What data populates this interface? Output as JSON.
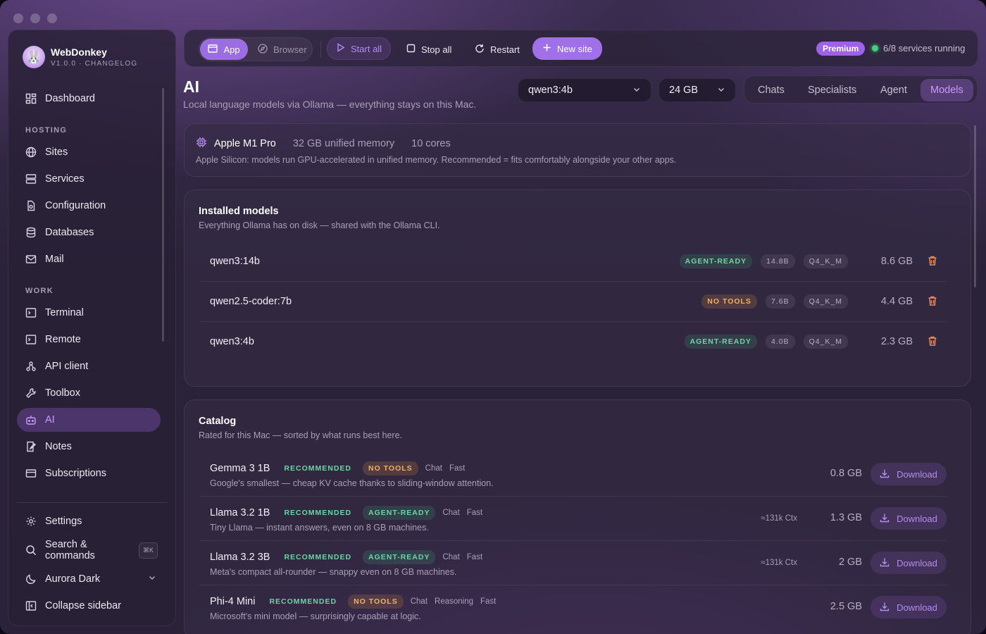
{
  "app": {
    "name": "WebDonkey",
    "version": "V1.0.0 · CHANGELOG"
  },
  "sidebar": {
    "items_top": [
      {
        "label": "Dashboard",
        "icon": "dashboard-icon"
      }
    ],
    "hosting_label": "HOSTING",
    "hosting": [
      {
        "label": "Sites",
        "icon": "globe-icon"
      },
      {
        "label": "Services",
        "icon": "server-icon"
      },
      {
        "label": "Configuration",
        "icon": "config-file-icon"
      },
      {
        "label": "Databases",
        "icon": "database-icon"
      },
      {
        "label": "Mail",
        "icon": "mail-icon"
      }
    ],
    "work_label": "WORK",
    "work": [
      {
        "label": "Terminal",
        "icon": "terminal-icon"
      },
      {
        "label": "Remote",
        "icon": "remote-terminal-icon"
      },
      {
        "label": "API client",
        "icon": "api-icon"
      },
      {
        "label": "Toolbox",
        "icon": "wrench-icon"
      },
      {
        "label": "AI",
        "icon": "robot-icon",
        "active": true
      },
      {
        "label": "Notes",
        "icon": "notes-icon"
      },
      {
        "label": "Subscriptions",
        "icon": "card-icon"
      }
    ],
    "bottom": {
      "settings": "Settings",
      "search": "Search & commands",
      "search_kbd": "⌘K",
      "theme": "Aurora Dark",
      "collapse": "Collapse sidebar"
    }
  },
  "toolbar": {
    "app": "App",
    "browser": "Browser",
    "start_all": "Start all",
    "stop_all": "Stop all",
    "restart": "Restart",
    "new_site": "New site",
    "premium": "Premium",
    "services_status": "6/8 services running"
  },
  "header": {
    "title": "AI",
    "subtitle": "Local language models via Ollama — everything stays on this Mac.",
    "model_select": "qwen3:4b",
    "memory_select": "24 GB",
    "tabs": [
      "Chats",
      "Specialists",
      "Agent",
      "Models"
    ],
    "active_tab": "Models"
  },
  "hardware": {
    "chip": "Apple M1 Pro",
    "memory": "32 GB unified memory",
    "cores": "10 cores",
    "note": "Apple Silicon: models run GPU-accelerated in unified memory. Recommended = fits comfortably alongside your other apps."
  },
  "installed": {
    "title": "Installed models",
    "subtitle": "Everything Ollama has on disk — shared with the Ollama CLI.",
    "models": [
      {
        "name": "qwen3:14b",
        "badge": "AGENT-READY",
        "badge_color": "green",
        "params": "14.8B",
        "quant": "Q4_K_M",
        "size": "8.6 GB"
      },
      {
        "name": "qwen2.5-coder:7b",
        "badge": "NO TOOLS",
        "badge_color": "orange",
        "params": "7.6B",
        "quant": "Q4_K_M",
        "size": "4.4 GB"
      },
      {
        "name": "qwen3:4b",
        "badge": "AGENT-READY",
        "badge_color": "green",
        "params": "4.0B",
        "quant": "Q4_K_M",
        "size": "2.3 GB"
      }
    ]
  },
  "catalog": {
    "title": "Catalog",
    "subtitle": "Rated for this Mac — sorted by what runs best here.",
    "download_label": "Download",
    "models": [
      {
        "name": "Gemma 3 1B",
        "rec": "RECOMMENDED",
        "badge": "NO TOOLS",
        "badge_color": "orange",
        "keywords": [
          "Chat",
          "Fast"
        ],
        "desc": "Google's smallest — cheap KV cache thanks to sliding-window attention.",
        "ctx": "",
        "size": "0.8 GB"
      },
      {
        "name": "Llama 3.2 1B",
        "rec": "RECOMMENDED",
        "badge": "AGENT-READY",
        "badge_color": "green",
        "keywords": [
          "Chat",
          "Fast"
        ],
        "desc": "Tiny Llama — instant answers, even on 8 GB machines.",
        "ctx": "≈131k Ctx",
        "size": "1.3 GB"
      },
      {
        "name": "Llama 3.2 3B",
        "rec": "RECOMMENDED",
        "badge": "AGENT-READY",
        "badge_color": "green",
        "keywords": [
          "Chat",
          "Fast"
        ],
        "desc": "Meta's compact all-rounder — snappy even on 8 GB machines.",
        "ctx": "≈131k Ctx",
        "size": "2 GB"
      },
      {
        "name": "Phi-4 Mini",
        "rec": "RECOMMENDED",
        "badge": "NO TOOLS",
        "badge_color": "orange",
        "keywords": [
          "Chat",
          "Reasoning",
          "Fast"
        ],
        "desc": "Microsoft's mini model — surprisingly capable at logic.",
        "ctx": "",
        "size": "2.5 GB"
      }
    ]
  }
}
